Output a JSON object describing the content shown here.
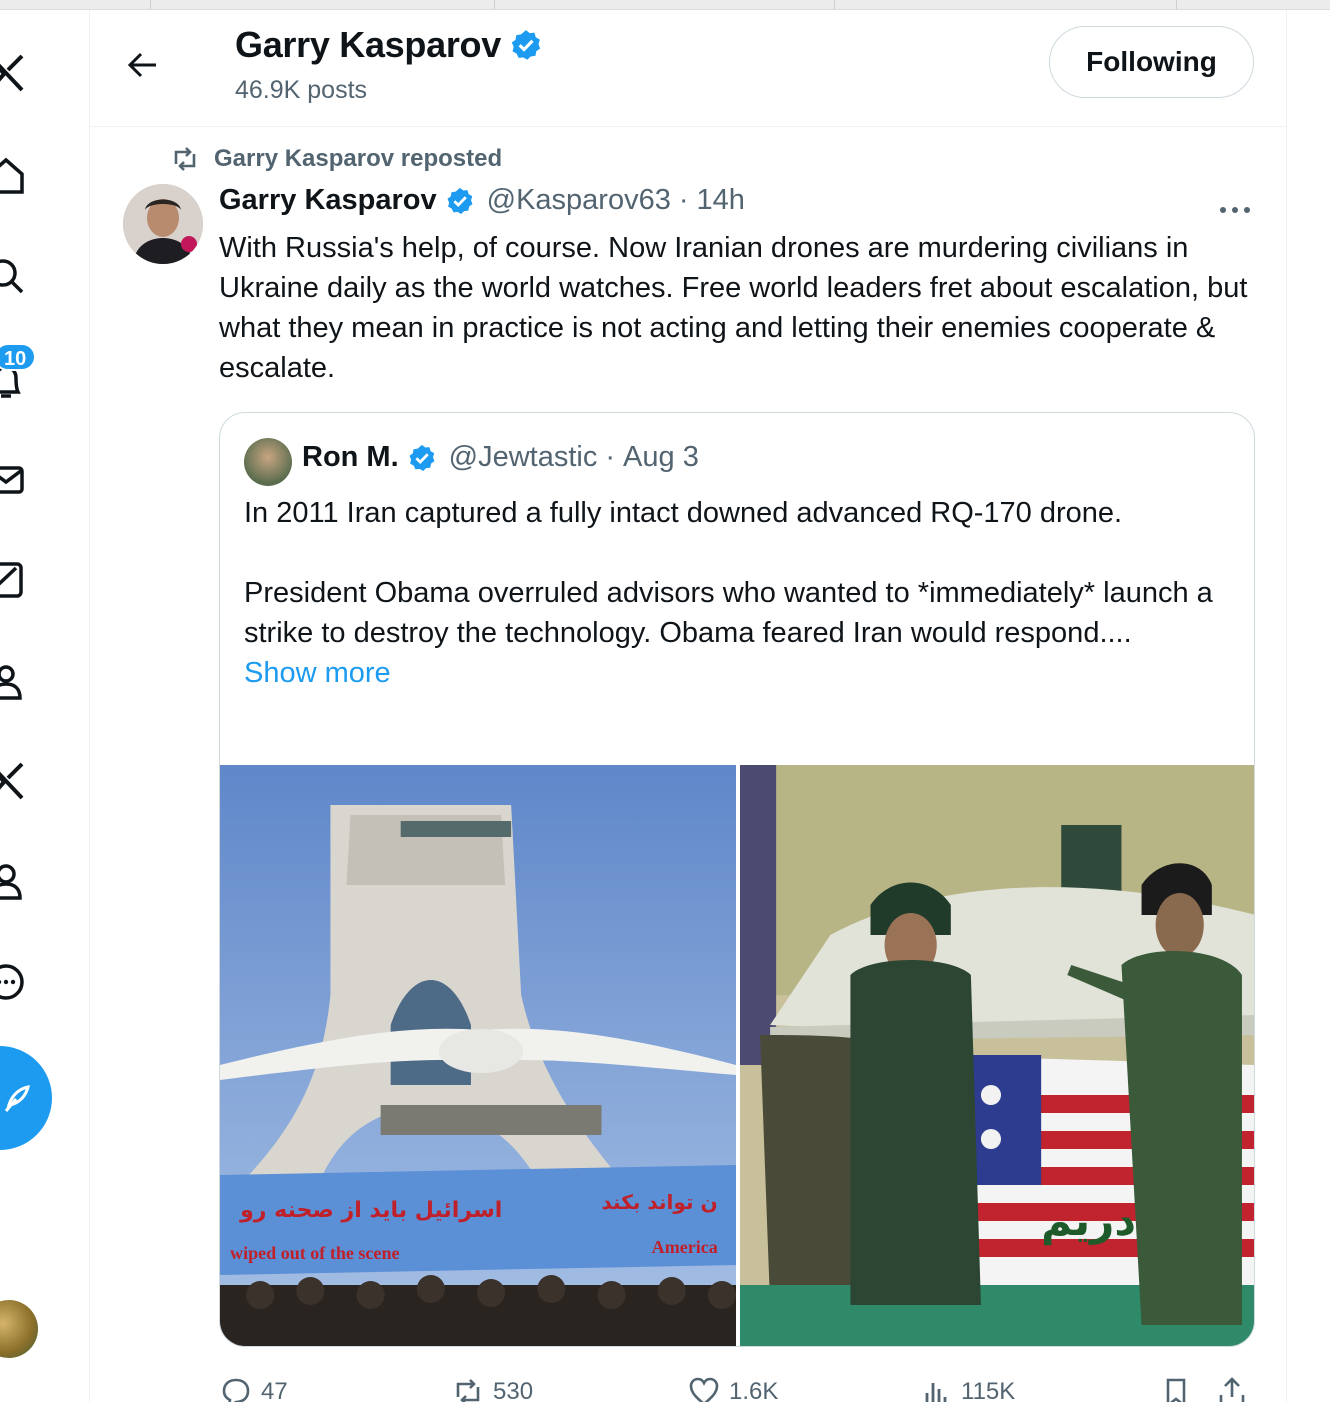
{
  "header": {
    "name": "Garry Kasparov",
    "posts": "46.9K posts",
    "follow_label": "Following"
  },
  "nav": {
    "notifications_badge": "10"
  },
  "tweet": {
    "repost_label": "Garry Kasparov reposted",
    "author_name": "Garry Kasparov",
    "handle": "@Kasparov63",
    "separator": "·",
    "time": "14h",
    "text": "With Russia's help, of course. Now Iranian drones are murdering civilians in Ukraine daily as the world watches. Free world leaders fret about escalation, but what they mean in practice is not acting and letting their enemies cooperate & escalate.",
    "quote": {
      "author_name": "Ron M.",
      "handle": "@Jewtastic",
      "separator": "·",
      "time": "Aug 3",
      "text": "In 2011 Iran captured a fully intact downed advanced RQ-170 drone.\n\nPresident Obama overruled advisors who wanted to *immediately* launch a strike to destroy the technology. Obama feared Iran would respond....",
      "show_more": "Show more",
      "image1_banner_fa": "اسرائیل باید از صحنه رو",
      "image1_banner_fa2": "ن تواند بکند",
      "image1_banner_en": "wiped out of the scene",
      "image1_banner_en2": "America",
      "image2_banner_fa": "ما قادریم"
    },
    "actions": {
      "replies": "47",
      "reposts": "530",
      "likes": "1.6K",
      "views": "115K"
    }
  },
  "colors": {
    "accent": "#1d9bf0",
    "text_primary": "#0f1419",
    "text_secondary": "#536471",
    "border": "#cfd9de"
  }
}
